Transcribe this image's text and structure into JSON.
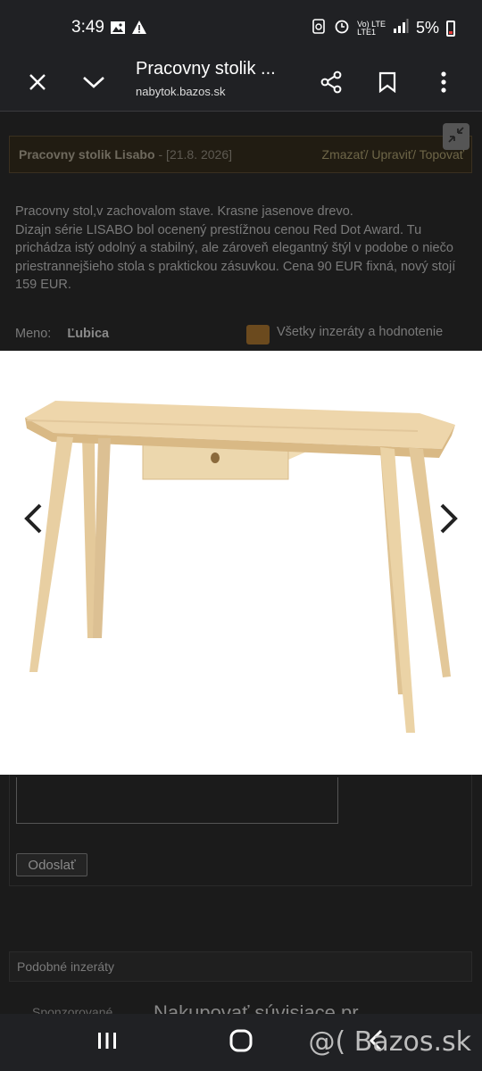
{
  "status": {
    "time": "3:49",
    "network": "Vo) LTE\nLTE1",
    "battery": "5%"
  },
  "appbar": {
    "title": "Pracovny stolik ...",
    "url": "nabytok.bazos.sk"
  },
  "ad": {
    "title": "Pracovny stolik Lisabo",
    "date": "- [21.8. 2026]",
    "actions": "Zmazať/ Upraviť/ Topovať",
    "description": "Pracovny stol,v zachovalom stave. Krasne jasenove drevo.\nDizajn série LISABO bol ocenený prestížnou cenou Red Dot Award. Tu prichádza istý odolný a stabilný, ale zároveň elegantný štýl v podobe o niečo priestrannejšieho stola s praktickou zásuvkou. Cena 90 EUR fixná, nový stojí 159 EUR.",
    "contact_label": "Meno:",
    "contact_name": "Ľubica",
    "all_ads": "Všetky inzeráty a hodnotenie"
  },
  "form": {
    "send_label": "Odoslať"
  },
  "similar": {
    "label": "Podobné inzeráty"
  },
  "sponsored": {
    "label": "Sponzorované",
    "title": "Nakupovať súvisiace pr"
  },
  "watermark": "@( Bazos.sk",
  "colors": {
    "wood": "#e8cf9f",
    "bar": "#202124"
  }
}
